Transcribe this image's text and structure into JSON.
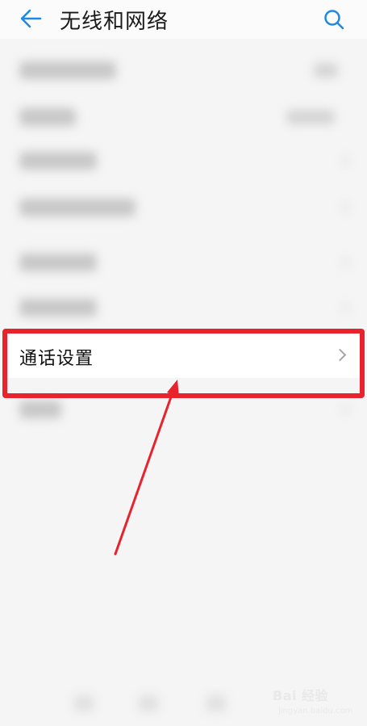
{
  "header": {
    "title": "无线和网络"
  },
  "highlighted_item": {
    "label": "通话设置"
  },
  "watermark": {
    "logo_text": "Bai 经验",
    "url": "jingyan.baidu.com"
  },
  "colors": {
    "accent": "#1e88e5",
    "highlight": "#e8232e"
  }
}
